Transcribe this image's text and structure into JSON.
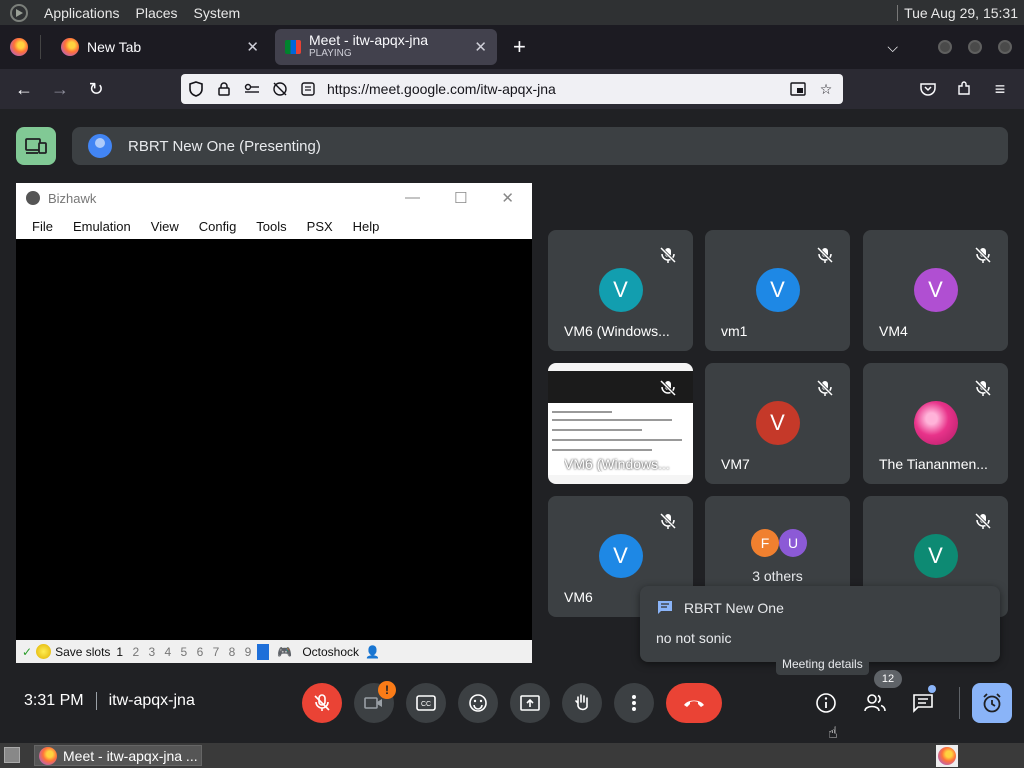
{
  "os_panel": {
    "menu": [
      "Applications",
      "Places",
      "System"
    ],
    "clock": "Tue Aug 29, 15:31"
  },
  "browser": {
    "tabs": [
      {
        "title": "New Tab",
        "subtitle": ""
      },
      {
        "title": "Meet - itw-apqx-jna",
        "subtitle": "PLAYING"
      }
    ],
    "url_prefix": "https://meet.",
    "url_domain": "google.com",
    "url_path": "/itw-apqx-jna"
  },
  "meet": {
    "presenter_bar": "RBRT New One (Presenting)",
    "shared_window": {
      "title": "Bizhawk",
      "menu": [
        "File",
        "Emulation",
        "View",
        "Config",
        "Tools",
        "PSX",
        "Help"
      ],
      "status_save": "Save slots",
      "slots": [
        "1",
        "2",
        "3",
        "4",
        "5",
        "6",
        "7",
        "8",
        "9"
      ],
      "core": "Octoshock"
    },
    "tiles": [
      {
        "name": "VM6 (Windows...",
        "initial": "V",
        "color": "#129eaf"
      },
      {
        "name": "vm1",
        "initial": "V",
        "color": "#1e88e5"
      },
      {
        "name": "VM4",
        "initial": "V",
        "color": "#b04fd2"
      },
      {
        "name": "VM6 (Windows...",
        "initial": "",
        "color": ""
      },
      {
        "name": "VM7",
        "initial": "V",
        "color": "#c53929"
      },
      {
        "name": "The Tiananmen...",
        "initial": "",
        "color": "#e8338a"
      },
      {
        "name": "VM6",
        "initial": "V",
        "color": "#1e88e5"
      },
      {
        "name": "3 others",
        "initial": "",
        "color": ""
      },
      {
        "name": "",
        "initial": "V",
        "color": "#0d8a73"
      }
    ],
    "others_avatars": [
      {
        "initial": "F",
        "color": "#f0802f"
      },
      {
        "initial": "U",
        "color": "#8c5ad6"
      }
    ],
    "chat_popup": {
      "sender": "RBRT New One",
      "message": "no not sonic"
    },
    "tooltip": "Meeting details",
    "time": "3:31 PM",
    "meeting_code": "itw-apqx-jna",
    "people_count": "12",
    "camera_warning": "!"
  },
  "taskbar": {
    "window": "Meet - itw-apqx-jna ..."
  }
}
